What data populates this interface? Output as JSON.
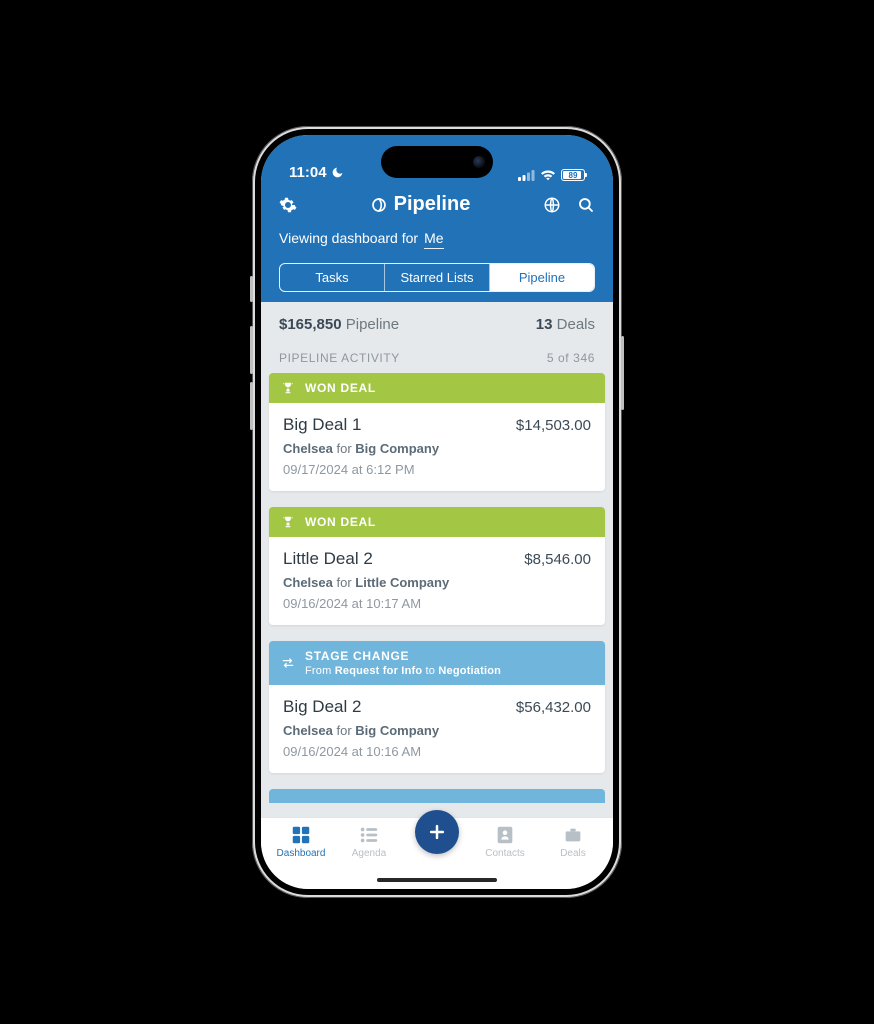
{
  "status": {
    "time": "11:04",
    "battery": "89"
  },
  "nav": {
    "title": "Pipeline",
    "viewing_label": "Viewing dashboard for",
    "viewing_value": "Me",
    "tabs": {
      "tasks": "Tasks",
      "starred": "Starred Lists",
      "pipeline": "Pipeline"
    }
  },
  "summary": {
    "amount": "$165,850",
    "amount_label": "Pipeline",
    "count": "13",
    "count_label": "Deals"
  },
  "section": {
    "title": "PIPELINE ACTIVITY",
    "count": "5 of 346"
  },
  "deals": [
    {
      "badge": "WON DEAL",
      "type": "won",
      "name": "Big Deal 1",
      "amount": "$14,503.00",
      "user": "Chelsea",
      "for_word": "for",
      "company": "Big Company",
      "timestamp": "09/17/2024 at 6:12 PM"
    },
    {
      "badge": "WON DEAL",
      "type": "won",
      "name": "Little Deal 2",
      "amount": "$8,546.00",
      "user": "Chelsea",
      "for_word": "for",
      "company": "Little Company",
      "timestamp": "09/16/2024 at 10:17 AM"
    },
    {
      "badge": "STAGE CHANGE",
      "type": "stage",
      "sub_pre": "From",
      "sub_from": "Request for Info",
      "sub_mid": "to",
      "sub_to": "Negotiation",
      "name": "Big Deal 2",
      "amount": "$56,432.00",
      "user": "Chelsea",
      "for_word": "for",
      "company": "Big Company",
      "timestamp": "09/16/2024 at 10:16 AM"
    }
  ],
  "tabbar": {
    "dashboard": "Dashboard",
    "agenda": "Agenda",
    "contacts": "Contacts",
    "deals": "Deals"
  }
}
